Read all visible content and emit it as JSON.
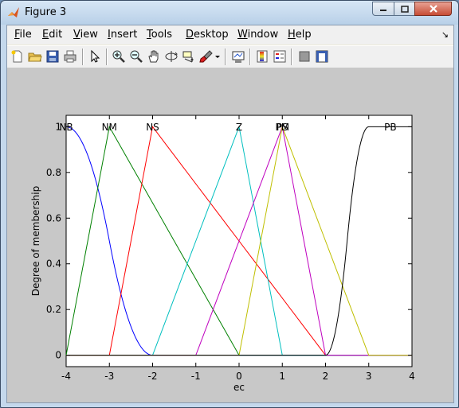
{
  "window": {
    "title": "Figure 3"
  },
  "menu": [
    {
      "label": "File",
      "mn": "F",
      "rest": "ile"
    },
    {
      "label": "Edit",
      "mn": "E",
      "rest": "dit"
    },
    {
      "label": "View",
      "mn": "V",
      "rest": "iew"
    },
    {
      "label": "Insert",
      "mn": "I",
      "rest": "nsert"
    },
    {
      "label": "Tools",
      "mn": "T",
      "rest": "ools"
    },
    {
      "label": "Desktop",
      "mn": "D",
      "rest": "esktop"
    },
    {
      "label": "Window",
      "mn": "W",
      "rest": "indow"
    },
    {
      "label": "Help",
      "mn": "H",
      "rest": "elp"
    }
  ],
  "toolbar": {
    "icons": [
      "new-figure-icon",
      "open-file-icon",
      "save-icon",
      "print-icon",
      "arrow-pointer-icon",
      "zoom-in-icon",
      "zoom-out-icon",
      "pan-hand-icon",
      "rotate-3d-icon",
      "data-cursor-icon",
      "brush-icon",
      "dropdown-arrow-icon",
      "link-plot-icon",
      "colorbar-icon",
      "legend-icon",
      "hide-plot-tools-icon",
      "show-plot-tools-icon"
    ]
  },
  "chart_data": {
    "type": "line",
    "xlabel": "ec",
    "ylabel": "Degree of membership",
    "xlim": [
      -4,
      4
    ],
    "ylim": [
      -0.05,
      1.05
    ],
    "xticks": [
      "-4",
      "-3",
      "-2",
      "-1",
      "0",
      "1",
      "2",
      "3",
      "4"
    ],
    "yticks": [
      "0",
      "0.2",
      "0.4",
      "0.6",
      "0.8",
      "1"
    ],
    "series": [
      {
        "name": "NB",
        "color": "#0000ff",
        "shape": "z",
        "params": [
          -4,
          -2
        ]
      },
      {
        "name": "NM",
        "color": "#008000",
        "shape": "tri",
        "params": [
          -4,
          -3,
          0
        ]
      },
      {
        "name": "NS",
        "color": "#ff0000",
        "shape": "tri",
        "params": [
          -3,
          -2,
          2
        ]
      },
      {
        "name": "Z",
        "color": "#00bfbf",
        "shape": "tri",
        "params": [
          -2,
          0,
          1
        ]
      },
      {
        "name": "PS",
        "color": "#bf00bf",
        "shape": "tri",
        "params": [
          -1,
          1,
          2
        ]
      },
      {
        "name": "PM",
        "color": "#bfbf00",
        "shape": "tri",
        "params": [
          0,
          1,
          3
        ]
      },
      {
        "name": "PB",
        "color": "#000000",
        "shape": "s",
        "params": [
          2,
          3
        ]
      }
    ],
    "labels": [
      {
        "text": "NB",
        "x": -4
      },
      {
        "text": "NM",
        "x": -3
      },
      {
        "text": "NS",
        "x": -2
      },
      {
        "text": "Z",
        "x": 0
      },
      {
        "text": "PS",
        "x": 1
      },
      {
        "text": "PM",
        "x": 1
      },
      {
        "text": "PB",
        "x": 3.5
      }
    ]
  }
}
